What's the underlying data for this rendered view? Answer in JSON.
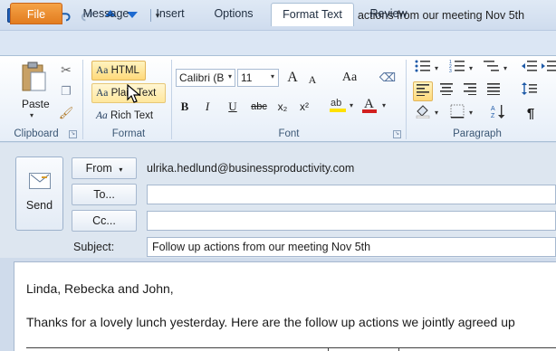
{
  "window": {
    "title": "Follow up actions from our meeting Nov 5th",
    "app_icon": "outlook-icon"
  },
  "quick_access": {
    "save_icon": "save-icon",
    "undo_icon": "undo-icon",
    "redo_icon": "redo-icon",
    "up_icon": "previous-item-icon",
    "down_icon": "next-item-icon",
    "customize_icon": "customize-qat-icon"
  },
  "tabs": [
    {
      "label": "File"
    },
    {
      "label": "Message"
    },
    {
      "label": "Insert"
    },
    {
      "label": "Options"
    },
    {
      "label": "Format Text"
    },
    {
      "label": "Review"
    }
  ],
  "ribbon": {
    "clipboard": {
      "label": "Clipboard",
      "paste": "Paste"
    },
    "format": {
      "label": "Format",
      "html": "HTML",
      "plain_text": "Plain Text",
      "rich_text": "Rich Text",
      "aa": "Aa"
    },
    "font": {
      "label": "Font",
      "font_name": "Calibri (B",
      "font_size": "11",
      "bold": "B",
      "italic": "I",
      "underline": "U",
      "strike": "abc",
      "subscript": "x₂",
      "superscript": "x²",
      "grow": "A",
      "shrink": "A",
      "change_case": "Aa"
    },
    "paragraph": {
      "label": "Paragraph",
      "pilcrow": "¶"
    }
  },
  "header": {
    "send": "Send",
    "from_button": "From",
    "from_value": "ulrika.hedlund@businessproductivity.com",
    "to_button": "To...",
    "cc_button": "Cc...",
    "to_value": "",
    "cc_value": "",
    "subject_label": "Subject:",
    "subject_value": "Follow up actions from our meeting Nov 5th"
  },
  "body": {
    "greeting": "Linda, Rebecka and John,",
    "text": "Thanks for a lovely lunch yesterday. Here are the follow up actions we jointly agreed up"
  },
  "colors": {
    "file_tab": "#e27c1f",
    "highlight": "#ffd97a",
    "ribbon_bg": "#e6eef8"
  }
}
